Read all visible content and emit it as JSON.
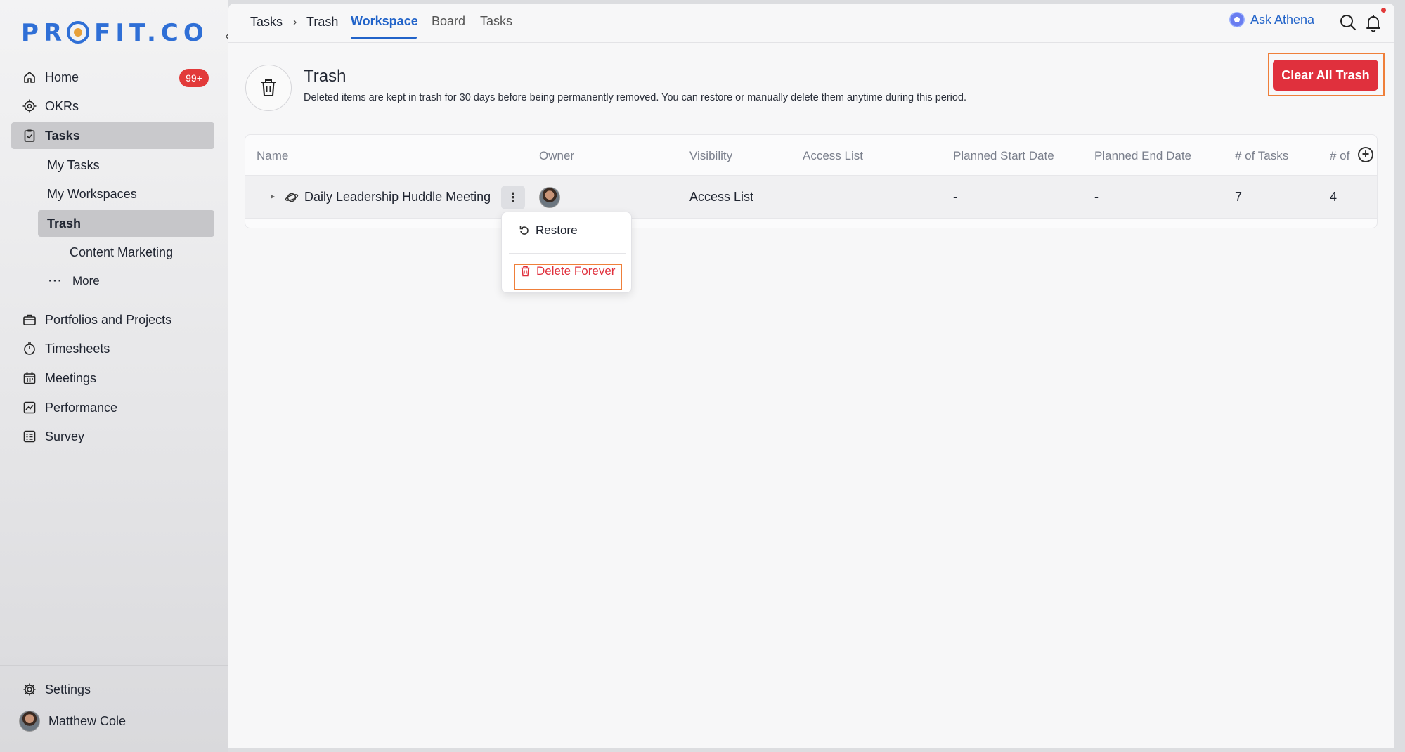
{
  "brand": {
    "logo_pre": "PR",
    "logo_post": "FIT.CO"
  },
  "sidebar": {
    "home": {
      "label": "Home",
      "badge": "99+"
    },
    "okrs": {
      "label": "OKRs"
    },
    "tasks": {
      "label": "Tasks"
    },
    "my_tasks": {
      "label": "My Tasks"
    },
    "my_workspaces": {
      "label": "My Workspaces"
    },
    "trash": {
      "label": "Trash"
    },
    "content_marketing": {
      "label": "Content Marketing"
    },
    "more": {
      "label": "More"
    },
    "portfolios": {
      "label": "Portfolios and Projects"
    },
    "timesheets": {
      "label": "Timesheets"
    },
    "meetings": {
      "label": "Meetings"
    },
    "performance": {
      "label": "Performance"
    },
    "survey": {
      "label": "Survey"
    },
    "settings": {
      "label": "Settings"
    },
    "user": {
      "name": "Matthew Cole"
    }
  },
  "topbar": {
    "breadcrumb": [
      "Tasks",
      "Trash"
    ],
    "tabs": [
      "Workspace",
      "Board",
      "Tasks"
    ],
    "active_tab": "Workspace",
    "ask_label": "Ask Athena"
  },
  "header": {
    "title": "Trash",
    "description": "Deleted items are kept in trash for 30 days before being permanently removed. You can restore or manually delete them anytime during this period.",
    "clear_button": "Clear All Trash"
  },
  "table": {
    "columns": [
      "Name",
      "Owner",
      "Visibility",
      "Access List",
      "Planned Start Date",
      "Planned End Date",
      "# of Tasks",
      "# of"
    ],
    "rows": [
      {
        "name": "Daily Leadership Huddle Meeting",
        "visibility": "Access List",
        "access_list": "",
        "planned_start": "-",
        "planned_end": "-",
        "tasks": "7",
        "extra": "4"
      }
    ]
  },
  "context_menu": {
    "restore": "Restore",
    "delete_forever": "Delete Forever"
  },
  "colors": {
    "accent": "#2163c9",
    "danger": "#e0303d",
    "highlight": "#ef7f3a"
  }
}
